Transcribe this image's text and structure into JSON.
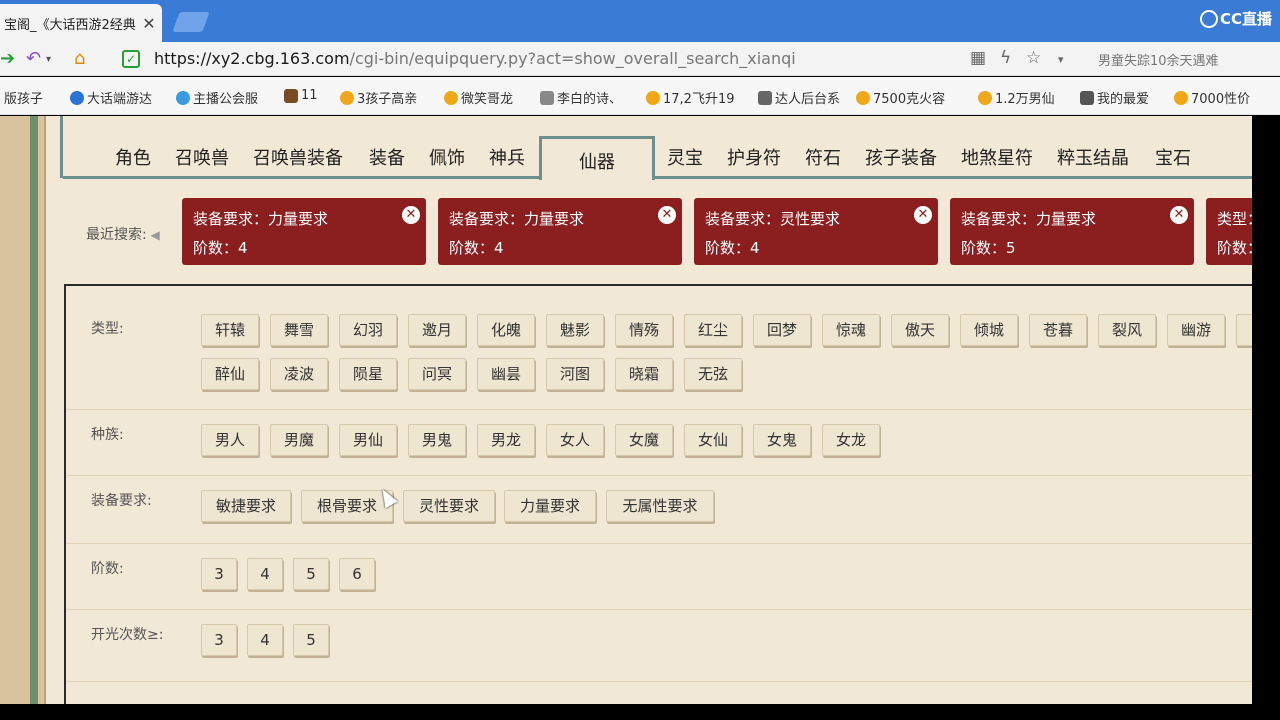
{
  "browser": {
    "tab_title": "宝阁_《大话西游2经典",
    "url_host": "https://xy2.cbg.163.com",
    "url_path": "/cgi-bin/equipquery.py?act=show_overall_search_xianqi",
    "search_hint": "男童失踪10余天遇难",
    "stream_logo": "CC直播"
  },
  "bookmarks": [
    {
      "label": "版孩子",
      "color": "#888888"
    },
    {
      "label": "大话端游达",
      "color": "#2a74d6"
    },
    {
      "label": "主播公会服",
      "color": "#3a9be0"
    },
    {
      "label": "11",
      "color": "#7a4a20"
    },
    {
      "label": "3孩子高亲",
      "color": "#f0a818"
    },
    {
      "label": "微笑哥龙",
      "color": "#f0a818"
    },
    {
      "label": "李白的诗、",
      "color": "#666666"
    },
    {
      "label": "17,2飞升19",
      "color": "#f0a818"
    },
    {
      "label": "达人后台系",
      "color": "#666666"
    },
    {
      "label": "7500克火容",
      "color": "#f0a818"
    },
    {
      "label": "1.2万男仙",
      "color": "#f0a818"
    },
    {
      "label": "我的最爱",
      "color": "#555555"
    },
    {
      "label": "7000性价",
      "color": "#f0a818"
    }
  ],
  "category_tabs": [
    {
      "label": "角色"
    },
    {
      "label": "召唤兽"
    },
    {
      "label": "召唤兽装备"
    },
    {
      "label": "装备"
    },
    {
      "label": "佩饰"
    },
    {
      "label": "神兵"
    },
    {
      "label": "仙器",
      "active": true
    },
    {
      "label": "灵宝"
    },
    {
      "label": "护身符"
    },
    {
      "label": "符石"
    },
    {
      "label": "孩子装备"
    },
    {
      "label": "地煞星符"
    },
    {
      "label": "粹玉结晶"
    },
    {
      "label": "宝石"
    }
  ],
  "recent_searches": {
    "label": "最近搜索:",
    "items": [
      {
        "line1": "装备要求：力量要求",
        "line2": "阶数：4"
      },
      {
        "line1": "装备要求：力量要求",
        "line2": "阶数：4"
      },
      {
        "line1": "装备要求：灵性要求",
        "line2": "阶数：4"
      },
      {
        "line1": "装备要求：力量要求",
        "line2": "阶数：5"
      },
      {
        "line1": "类型：",
        "line2": "阶数："
      }
    ]
  },
  "filters": {
    "type": {
      "label": "类型:",
      "options": [
        "轩辕",
        "舞雪",
        "幻羽",
        "邀月",
        "化魄",
        "魅影",
        "情殇",
        "红尘",
        "回梦",
        "惊魂",
        "傲天",
        "倾城",
        "苍暮",
        "裂风",
        "幽游",
        "醉仙",
        "凌波",
        "陨星",
        "问冥",
        "幽昙",
        "河图",
        "晓霜",
        "无弦"
      ]
    },
    "race": {
      "label": "种族:",
      "options": [
        "男人",
        "男魔",
        "男仙",
        "男鬼",
        "男龙",
        "女人",
        "女魔",
        "女仙",
        "女鬼",
        "女龙"
      ]
    },
    "requirement": {
      "label": "装备要求:",
      "options": [
        "敏捷要求",
        "根骨要求",
        "灵性要求",
        "力量要求",
        "无属性要求"
      ]
    },
    "tier": {
      "label": "阶数:",
      "options": [
        "3",
        "4",
        "5",
        "6"
      ]
    },
    "glow_count": {
      "label": "开光次数≥:",
      "options": [
        "3",
        "4",
        "5"
      ]
    }
  }
}
